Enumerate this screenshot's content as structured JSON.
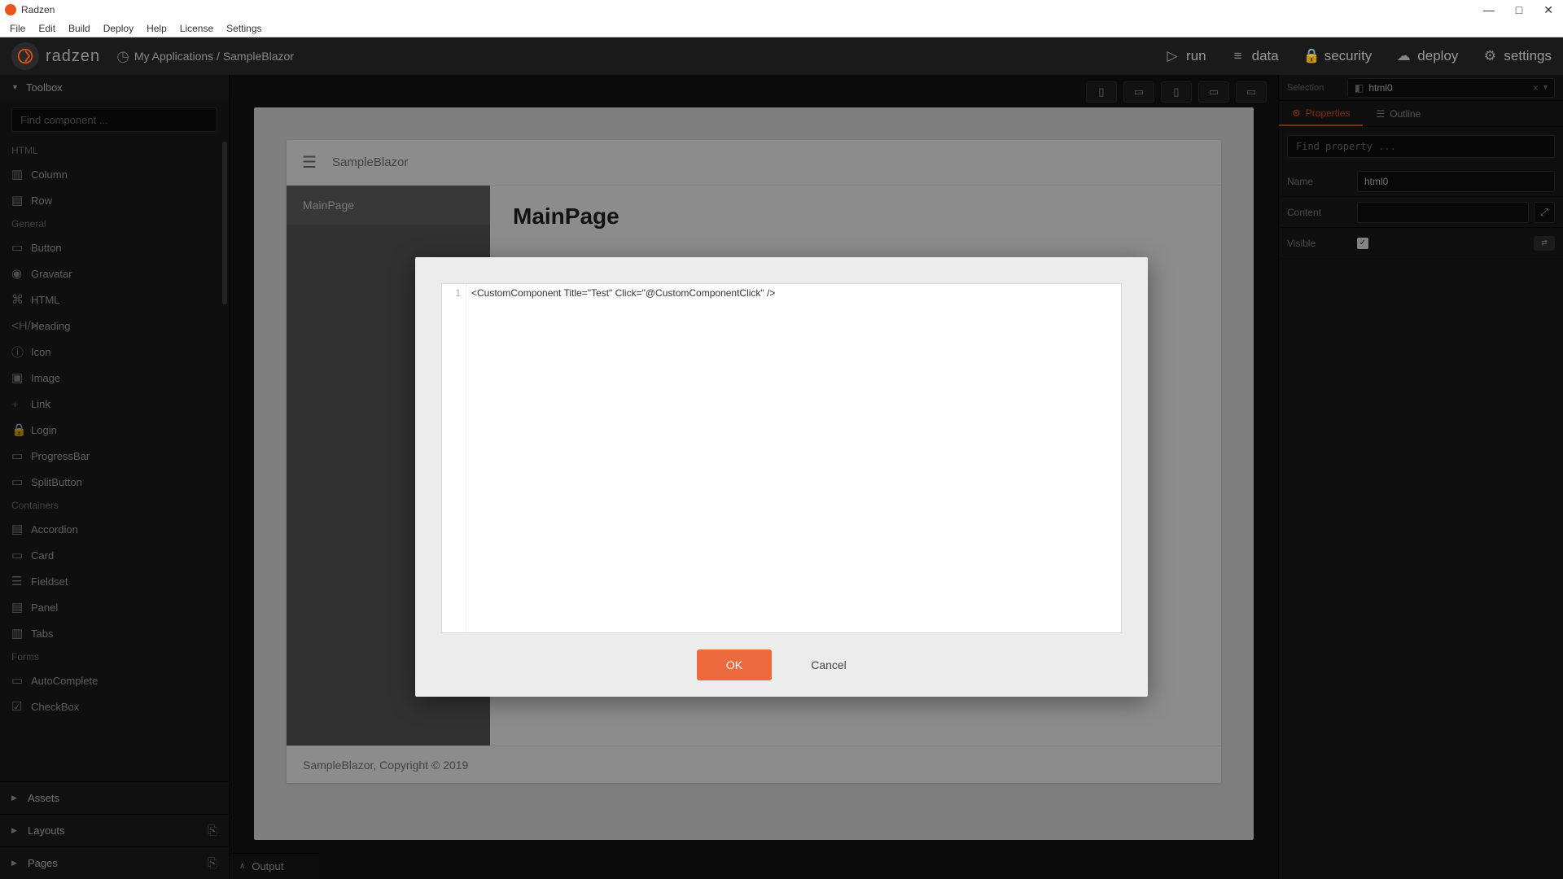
{
  "window": {
    "title": "Radzen"
  },
  "menubar": [
    "File",
    "Edit",
    "Build",
    "Deploy",
    "Help",
    "License",
    "Settings"
  ],
  "header": {
    "brand": "radzen",
    "breadcrumb": "My Applications / SampleBlazor",
    "actions": {
      "run": "run",
      "data": "data",
      "security": "security",
      "deploy": "deploy",
      "settings": "settings"
    }
  },
  "sidebar": {
    "toolbox_label": "Toolbox",
    "search_placeholder": "Find component ...",
    "cat_html": "HTML",
    "html_items": [
      "Column",
      "Row"
    ],
    "cat_general": "General",
    "general_items": [
      "Button",
      "Gravatar",
      "HTML",
      "Heading",
      "Icon",
      "Image",
      "Link",
      "Login",
      "ProgressBar",
      "SplitButton"
    ],
    "cat_containers": "Containers",
    "container_items": [
      "Accordion",
      "Card",
      "Fieldset",
      "Panel",
      "Tabs"
    ],
    "cat_forms": "Forms",
    "forms_items": [
      "AutoComplete",
      "CheckBox"
    ],
    "assets": "Assets",
    "layouts": "Layouts",
    "pages": "Pages"
  },
  "preview": {
    "app_title": "SampleBlazor",
    "nav_item": "MainPage",
    "page_heading": "MainPage",
    "footer": "SampleBlazor, Copyright © 2019"
  },
  "rightpanel": {
    "selection_label": "Selection",
    "selection_value": "html0",
    "tab_properties": "Properties",
    "tab_outline": "Outline",
    "find_placeholder": "Find property ...",
    "prop_name_label": "Name",
    "prop_name_value": "html0",
    "prop_content_label": "Content",
    "prop_content_value": "",
    "prop_visible_label": "Visible"
  },
  "modal": {
    "line_no": "1",
    "code": "<CustomComponent Title=\"Test\" Click=\"@CustomComponentClick\" />",
    "ok": "OK",
    "cancel": "Cancel"
  },
  "output": {
    "label": "Output"
  }
}
